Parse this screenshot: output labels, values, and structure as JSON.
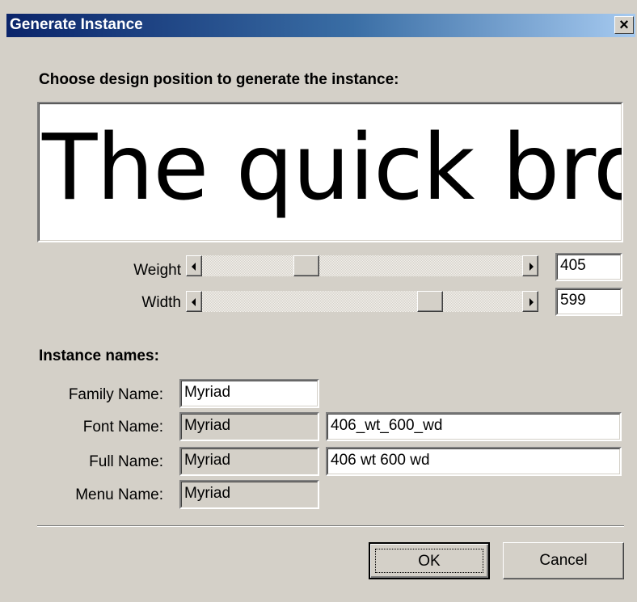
{
  "window": {
    "title": "Generate Instance",
    "close_glyph": "✕"
  },
  "design": {
    "heading": "Choose design position to generate the instance:",
    "preview_text": "The quick brow",
    "weight": {
      "label": "Weight",
      "value": "405",
      "position": 0.31
    },
    "width": {
      "label": "Width",
      "value": "599",
      "position": 0.73
    }
  },
  "names": {
    "heading": "Instance names:",
    "family": {
      "label": "Family Name:",
      "value": "Myriad"
    },
    "font": {
      "label": "Font Name:",
      "value": "Myriad",
      "suffix": "406_wt_600_wd"
    },
    "full": {
      "label": "Full Name:",
      "value": "Myriad",
      "suffix": "406 wt 600 wd"
    },
    "menu": {
      "label": "Menu Name:",
      "value": "Myriad"
    }
  },
  "buttons": {
    "ok": "OK",
    "cancel": "Cancel"
  }
}
